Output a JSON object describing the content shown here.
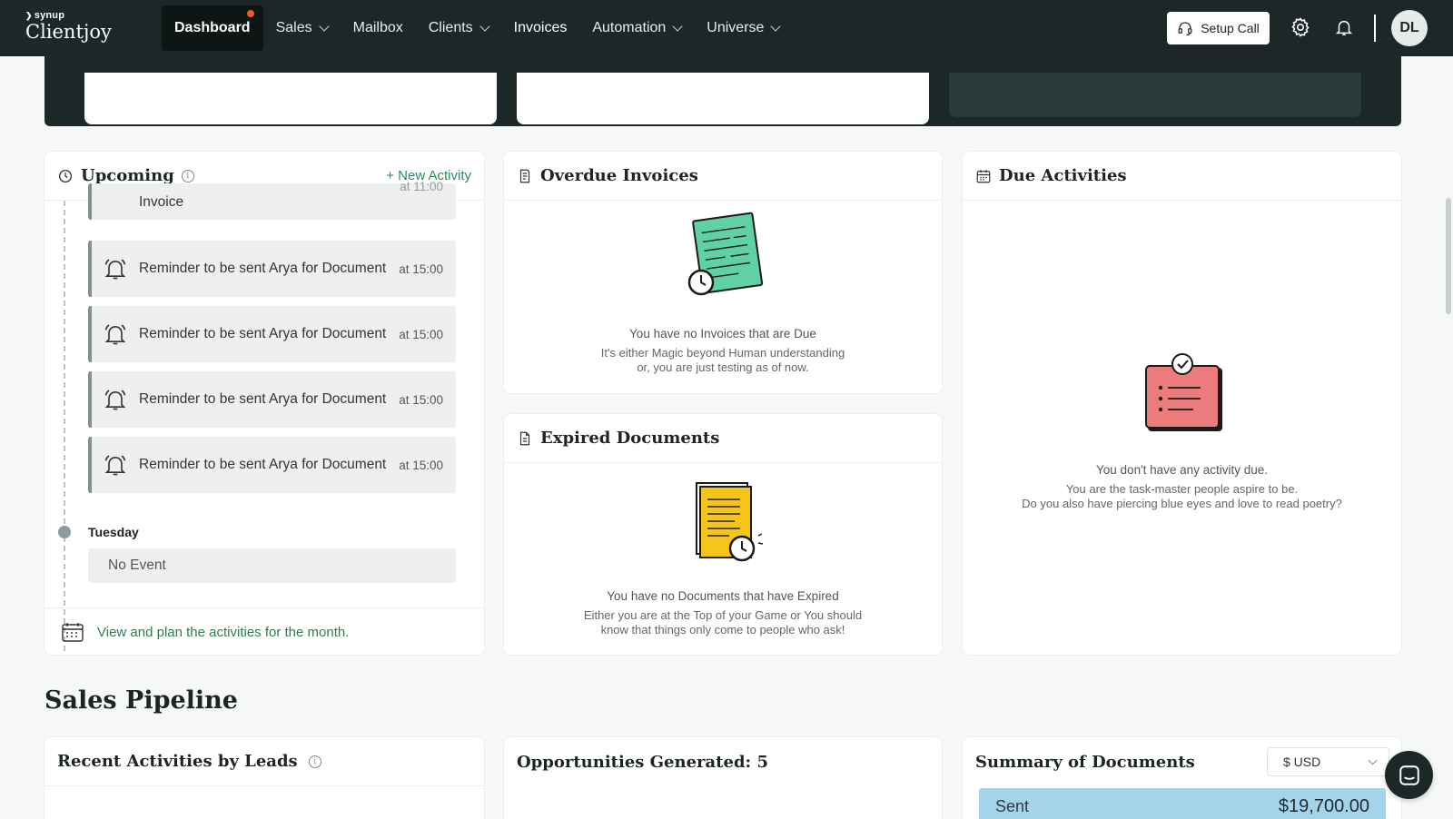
{
  "brand": {
    "small": "synup",
    "name": "Clientjoy"
  },
  "nav": {
    "items": [
      {
        "label": "Dashboard",
        "active": true,
        "dropdown": false
      },
      {
        "label": "Sales",
        "active": false,
        "dropdown": true
      },
      {
        "label": "Mailbox",
        "active": false,
        "dropdown": false
      },
      {
        "label": "Clients",
        "active": false,
        "dropdown": true
      },
      {
        "label": "Invoices",
        "active": false,
        "dropdown": false
      },
      {
        "label": "Automation",
        "active": false,
        "dropdown": true
      },
      {
        "label": "Universe",
        "active": false,
        "dropdown": true
      }
    ],
    "setup_call": "Setup Call",
    "avatar_initials": "DL",
    "accent": "#f05a28"
  },
  "upcoming": {
    "title": "Upcoming",
    "new_activity": "+ New Activity",
    "partial_event": {
      "text": "Invoice",
      "time": "at 11:00"
    },
    "events": [
      {
        "text": "Reminder to be sent Arya for Document",
        "time": "at 15:00"
      },
      {
        "text": "Reminder to be sent Arya for Document",
        "time": "at 15:00"
      },
      {
        "text": "Reminder to be sent Arya for Document",
        "time": "at 15:00"
      },
      {
        "text": "Reminder to be sent Arya for Document",
        "time": "at 15:00"
      }
    ],
    "day_label": "Tuesday",
    "no_event": "No Event",
    "footer_link": "View and plan the activities for the month."
  },
  "overdue": {
    "title": "Overdue Invoices",
    "empty_title": "You have no Invoices that are Due",
    "empty_line1": "It's either Magic beyond Human understanding",
    "empty_line2": "or, you are just testing as of now."
  },
  "expired": {
    "title": "Expired Documents",
    "empty_title": "You have no Documents that have Expired",
    "empty_line1": "Either you are at the Top of your Game or You should",
    "empty_line2": "know that things only come to people who ask!"
  },
  "due": {
    "title": "Due Activities",
    "empty_title": "You don't have any activity due.",
    "empty_line1": "You are the task-master people aspire to be.",
    "empty_line2": "Do you also have piercing blue eyes and love to read poetry?"
  },
  "pipeline": {
    "section_title": "Sales Pipeline",
    "recent_title": "Recent Activities by Leads",
    "opportunities_title": "Opportunities Generated: 5",
    "summary_title": "Summary of Documents",
    "currency": "$ USD",
    "sent_label": "Sent",
    "sent_amount": "$19,700.00"
  }
}
